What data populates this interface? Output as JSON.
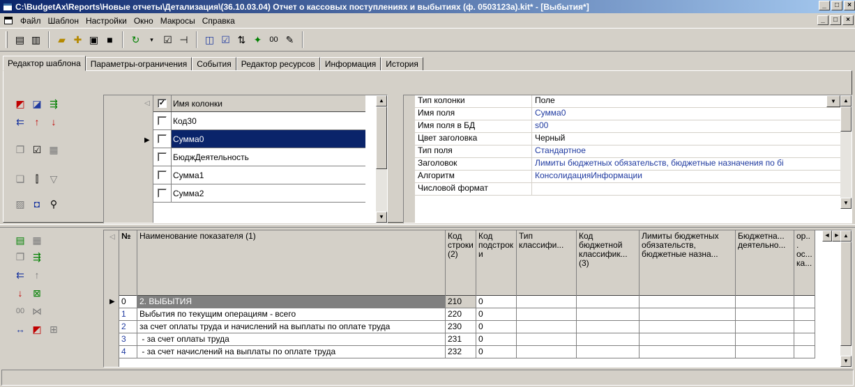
{
  "window": {
    "title": "C:\\BudgetAx\\Reports\\Новые отчеты\\Детализация\\(36.10.03.04) Отчет о кассовых поступлениях и выбытиях (ф. 0503123а).kit* - [Выбытия*]",
    "minimize": "_",
    "maximize": "□",
    "close": "×"
  },
  "menu": [
    "Файл",
    "Шаблон",
    "Настройки",
    "Окно",
    "Макросы",
    "Справка"
  ],
  "tabs": [
    "Редактор шаблона",
    "Параметры-ограничения",
    "События",
    "Редактор ресурсов",
    "Информация",
    "История"
  ],
  "columns_list": {
    "header": "Имя колонки",
    "items": [
      "Код30",
      "Сумма0",
      "БюджДеятельность",
      "Сумма1",
      "Сумма2"
    ],
    "selected": "Сумма0"
  },
  "properties": [
    {
      "key": "Тип колонки",
      "value": "Поле"
    },
    {
      "key": "Имя поля",
      "value": "Сумма0"
    },
    {
      "key": "Имя поля в БД",
      "value": "s00"
    },
    {
      "key": "Цвет заголовка",
      "value": "Черный"
    },
    {
      "key": "Тип поля",
      "value": "Стандартное"
    },
    {
      "key": "Заголовок",
      "value": "Лимиты бюджетных обязательств, бюджетные назначения по бі"
    },
    {
      "key": "Алгоритм",
      "value": "КонсолидацияИнформации"
    },
    {
      "key": "Числовой формат",
      "value": ""
    }
  ],
  "grid": {
    "headers": [
      "№",
      "Наименование показателя (1)",
      "Код строки (2)",
      "Код подстроки",
      "Тип классифи...",
      "Код бюджетной классифик... (3)",
      "Лимиты бюджетных обязательств, бюджетные назна...",
      "Бюджетна... деятельно...",
      "ор... ос... ка..."
    ],
    "rows": [
      [
        "0",
        "2. ВЫБЫТИЯ",
        "210",
        "0"
      ],
      [
        "1",
        "Выбытия по текущим операциям - всего",
        "220",
        "0"
      ],
      [
        "2",
        "за счет оплаты труда и начислений на выплаты по оплате труда",
        "230",
        "0"
      ],
      [
        "3",
        " - за счет оплаты труда",
        "231",
        "0"
      ],
      [
        "4",
        " - за счет начислений на выплаты по оплате труда",
        "232",
        "0"
      ]
    ]
  },
  "icons": {
    "oo": "00"
  }
}
